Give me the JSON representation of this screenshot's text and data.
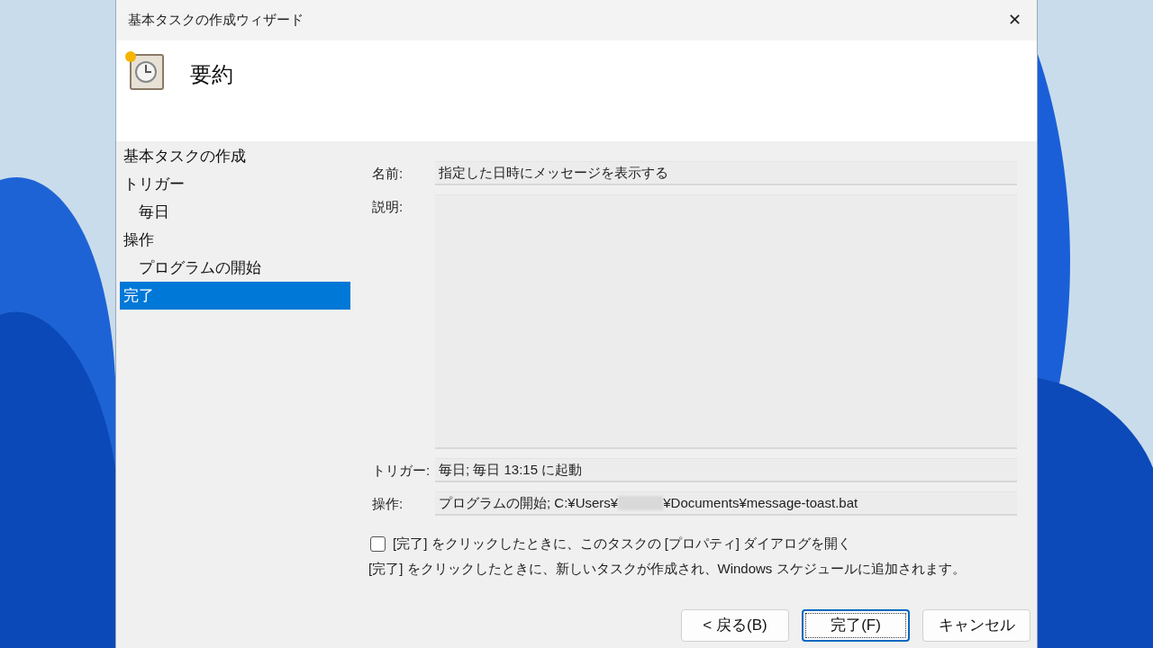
{
  "window": {
    "title": "基本タスクの作成ウィザード",
    "close": "✕"
  },
  "header": {
    "title": "要約"
  },
  "sidebar": {
    "items": [
      {
        "label": "基本タスクの作成",
        "selected": false
      },
      {
        "label": "トリガー",
        "selected": false,
        "children": [
          {
            "label": "毎日",
            "selected": false
          }
        ]
      },
      {
        "label": "操作",
        "selected": false,
        "children": [
          {
            "label": "プログラムの開始",
            "selected": false
          }
        ]
      },
      {
        "label": "完了",
        "selected": true
      }
    ]
  },
  "fields": [
    {
      "kind": "line",
      "label": "名前:",
      "value": "指定した日時にメッセージを表示する"
    },
    {
      "kind": "area",
      "label": "説明:"
    },
    {
      "kind": "line",
      "label": "トリガー:",
      "value": "毎日; 毎日 13:15 に起動"
    },
    {
      "kind": "redacted",
      "label": "操作:",
      "value": "プログラムの開始; C:¥Users¥",
      "value_after": "¥Documents¥message-toast.bat"
    }
  ],
  "checkbox": {
    "label": "[完了] をクリックしたときに、このタスクの [プロパティ] ダイアログを開く",
    "checked": false
  },
  "note": "[完了] をクリックしたときに、新しいタスクが作成され、Windows スケジュールに追加されます。",
  "buttons": [
    {
      "label": "< 戻る(B)",
      "focused": false
    },
    {
      "label": "完了(F)",
      "focused": true
    },
    {
      "label": "キャンセル",
      "focused": false
    }
  ]
}
